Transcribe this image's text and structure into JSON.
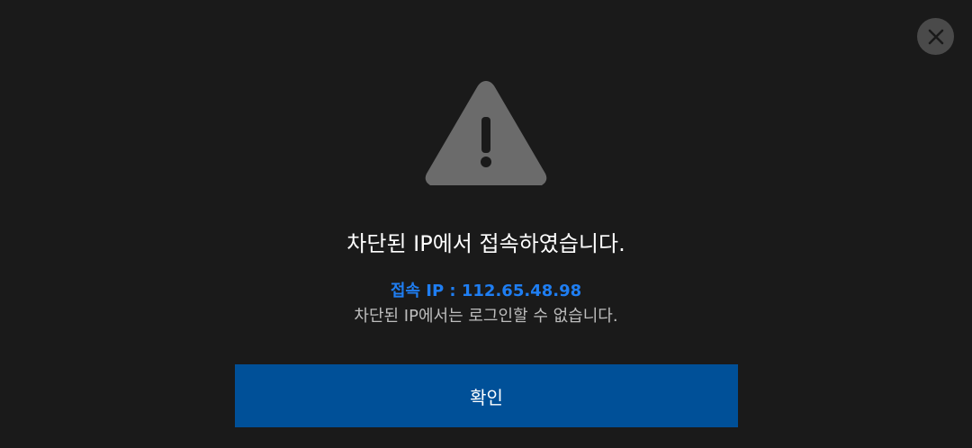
{
  "dialog": {
    "title": "차단된 IP에서 접속하였습니다.",
    "ip_line": "접속 IP : 112.65.48.98",
    "description": "차단된 IP에서는 로그인할 수 없습니다.",
    "confirm_label": "확인",
    "close_icon": "close-icon",
    "warning_icon": "warning-triangle-icon"
  },
  "colors": {
    "background": "#1a1a1a",
    "accent_text": "#1f7ef2",
    "button": "#005098",
    "icon_gray": "#6b6b6b"
  }
}
